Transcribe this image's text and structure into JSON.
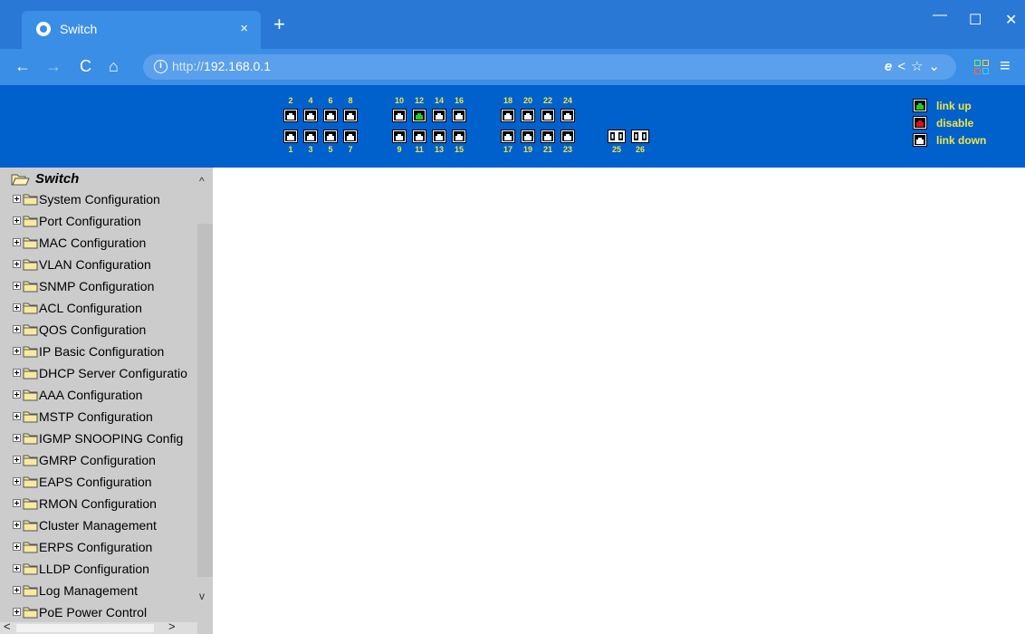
{
  "browser": {
    "tab_title": "Switch",
    "tab_close": "×",
    "new_tab": "+",
    "window_controls": {
      "minimize": "—",
      "maximize": "☐",
      "close": "✕"
    },
    "nav": {
      "back": "←",
      "forward": "→",
      "reload": "C",
      "home": "⌂"
    },
    "url_protocol": "http://",
    "url_host": "192.168.0.1",
    "info_icon": "i",
    "omnibox_icons": {
      "ie": "e",
      "share": "<",
      "star": "☆",
      "dropdown": "⌄"
    },
    "menu": "≡"
  },
  "port_panel": {
    "groups": [
      {
        "top": [
          "2",
          "4",
          "6",
          "8"
        ],
        "bottom": [
          "1",
          "3",
          "5",
          "7"
        ]
      },
      {
        "top": [
          "10",
          "12",
          "14",
          "16"
        ],
        "bottom": [
          "9",
          "11",
          "13",
          "15"
        ]
      },
      {
        "top": [
          "18",
          "20",
          "22",
          "24"
        ],
        "bottom": [
          "17",
          "19",
          "21",
          "23"
        ]
      }
    ],
    "fiber_ports": [
      "25",
      "26"
    ],
    "link_up_ports": [
      "12"
    ],
    "legend": [
      {
        "label": "link up",
        "color": "#22cc22"
      },
      {
        "label": "disable",
        "color": "#dd1111"
      },
      {
        "label": "link down",
        "color": "#ffffff"
      }
    ]
  },
  "colors": {
    "titlebar": "#2a78d6",
    "toolbar": "#3a8ee6",
    "port_panel_bg": "#0060cc",
    "port_label": "#f2e642",
    "sidebar_bg": "#cccccc"
  },
  "sidebar": {
    "root": "Switch",
    "items": [
      "System Configuration",
      "Port Configuration",
      "MAC Configuration",
      "VLAN Configuration",
      "SNMP Configuration",
      "ACL Configuration",
      "QOS Configuration",
      "IP Basic Configuration",
      "DHCP Server Configuratio",
      "AAA Configuration",
      "MSTP Configuration",
      "IGMP SNOOPING Config",
      "GMRP Configuration",
      "EAPS Configuration",
      "RMON Configuration",
      "Cluster Management",
      "ERPS Configuration",
      "LLDP Configuration",
      "Log Management",
      "PoE Power Control"
    ],
    "scroll_up": "^",
    "scroll_down": "v",
    "scroll_left": "<",
    "scroll_right": ">"
  }
}
